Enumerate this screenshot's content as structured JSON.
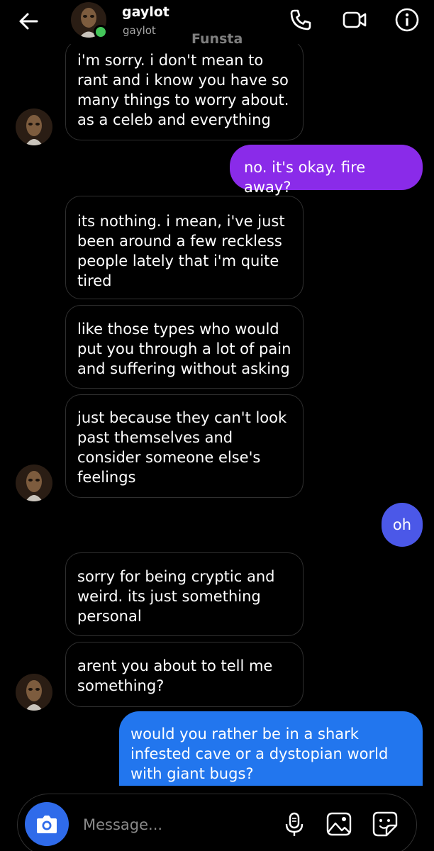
{
  "header": {
    "name": "gaylot",
    "handle": "gaylot",
    "chat_label": "Funsta",
    "status_color": "#44c65a",
    "icons": [
      "back-arrow-icon",
      "phone-icon",
      "video-icon",
      "info-icon"
    ]
  },
  "messages": [
    {
      "side": "in",
      "text": "i'm sorry. i don't mean to rant and i know you have so many things to worry about. as a celeb and everything"
    },
    {
      "side": "out",
      "text": "no. it's okay. fire away?",
      "color": "#8a2be9"
    },
    {
      "side": "in",
      "text": "its nothing. i mean, i've just been around a few reckless people lately that i'm quite tired"
    },
    {
      "side": "in",
      "text": "like those types who would put you through a lot of pain and suffering without asking"
    },
    {
      "side": "in",
      "text": "just because they can't look past themselves and consider someone else's feelings"
    },
    {
      "side": "out",
      "text": "oh",
      "color": "#4b58e8"
    },
    {
      "side": "in",
      "text": "sorry for being cryptic and weird. its just something personal"
    },
    {
      "side": "in",
      "text": "arent you about to tell me something?"
    },
    {
      "side": "out",
      "text": "would you rather be in a shark infested cave or a dystopian world with giant bugs?",
      "color": "#2276ee"
    }
  ],
  "composer": {
    "placeholder": "Message...",
    "camera_color": "#2f6bea",
    "icons": [
      "camera-icon",
      "microphone-icon",
      "gallery-icon",
      "sticker-icon"
    ]
  }
}
